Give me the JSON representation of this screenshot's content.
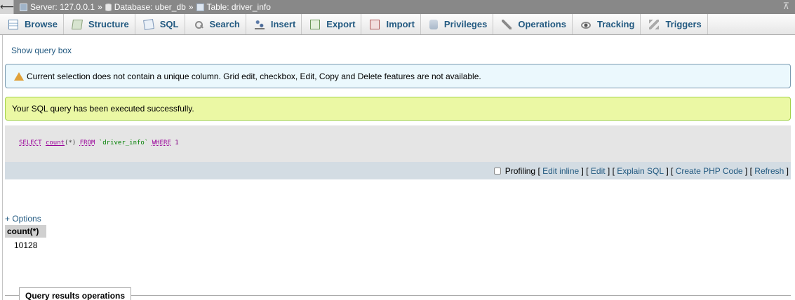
{
  "breadcrumb": {
    "back_glyph": "⟵",
    "server": "Server: 127.0.0.1",
    "database": "Database: uber_db",
    "table": "Table: driver_info",
    "separator": "»",
    "collapse_glyph": "⊼"
  },
  "tabs": [
    {
      "label": "Browse",
      "icon": "browse-icon"
    },
    {
      "label": "Structure",
      "icon": "structure-icon"
    },
    {
      "label": "SQL",
      "icon": "sql-icon"
    },
    {
      "label": "Search",
      "icon": "search-icon"
    },
    {
      "label": "Insert",
      "icon": "insert-icon"
    },
    {
      "label": "Export",
      "icon": "export-icon"
    },
    {
      "label": "Import",
      "icon": "import-icon"
    },
    {
      "label": "Privileges",
      "icon": "privileges-icon"
    },
    {
      "label": "Operations",
      "icon": "operations-icon"
    },
    {
      "label": "Tracking",
      "icon": "tracking-icon"
    },
    {
      "label": "Triggers",
      "icon": "triggers-icon"
    }
  ],
  "show_query_box": "Show query box",
  "notice": {
    "text": "Current selection does not contain a unique column. Grid edit, checkbox, Edit, Copy and Delete features are not available.",
    "icon": "warning-icon"
  },
  "success": {
    "text": "Your SQL query has been executed successfully."
  },
  "sql": {
    "select": "SELECT",
    "count": "count",
    "args": "(*)",
    "from": "FROM",
    "table": "`driver_info`",
    "where": "WHERE",
    "value": "1"
  },
  "tools": {
    "profiling": "Profiling",
    "edit_inline": "Edit inline",
    "edit": "Edit",
    "explain_sql": "Explain SQL",
    "create_php_code": "Create PHP Code",
    "refresh": "Refresh",
    "open_bracket": "[",
    "close_bracket": "]"
  },
  "options_link": "+ Options",
  "result": {
    "column": "count(*)",
    "value": "10128"
  },
  "query_results_operations": "Query results operations",
  "colors": {
    "topbar": "#888888",
    "link": "#235a81",
    "notice_bg": "#ebf8fd",
    "success_bg": "#ebf8a4",
    "toolbar_bg": "#d3dce3"
  }
}
